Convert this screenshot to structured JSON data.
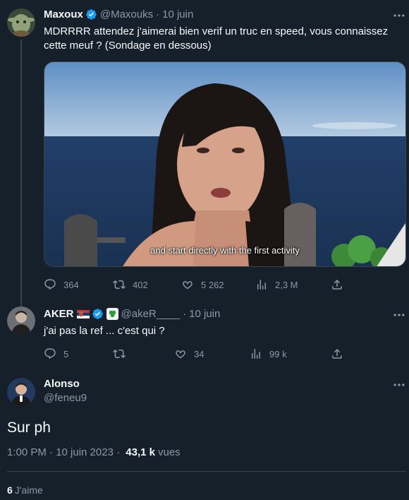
{
  "tweet1": {
    "name": "Maxoux",
    "handle": "@Maxouks",
    "date": "10 juin",
    "text_line1": "MDRRRR attendez j'aimerai bien verif un truc en speed, vous connaissez",
    "text_line2": "cette meuf ? (Sondage en dessous)",
    "video_caption": "and start directly with the first activity",
    "stats": {
      "replies": "364",
      "retweets": "402",
      "likes": "5 262",
      "views": "2,3 M"
    }
  },
  "tweet2": {
    "name": "AKER",
    "handle": "@akeR____",
    "date": "10 juin",
    "text": "j'ai pas la ref ... c'est qui ?",
    "stats": {
      "replies": "5",
      "retweets": "",
      "likes": "34",
      "views": "99 k"
    }
  },
  "main_tweet": {
    "name": "Alonso",
    "handle": "@feneu9",
    "text": "Sur ph",
    "time": "1:00 PM · 10 juin 2023 · ",
    "views_count": "43,1 k",
    "views_label": "vues",
    "likes_count": "6",
    "likes_label": "J'aime"
  },
  "separator_dot": "·",
  "colors": {
    "background": "#15202b",
    "secondary_text": "#8b98a5",
    "verified_blue": "#1d9bf0",
    "divider": "#38444d"
  }
}
